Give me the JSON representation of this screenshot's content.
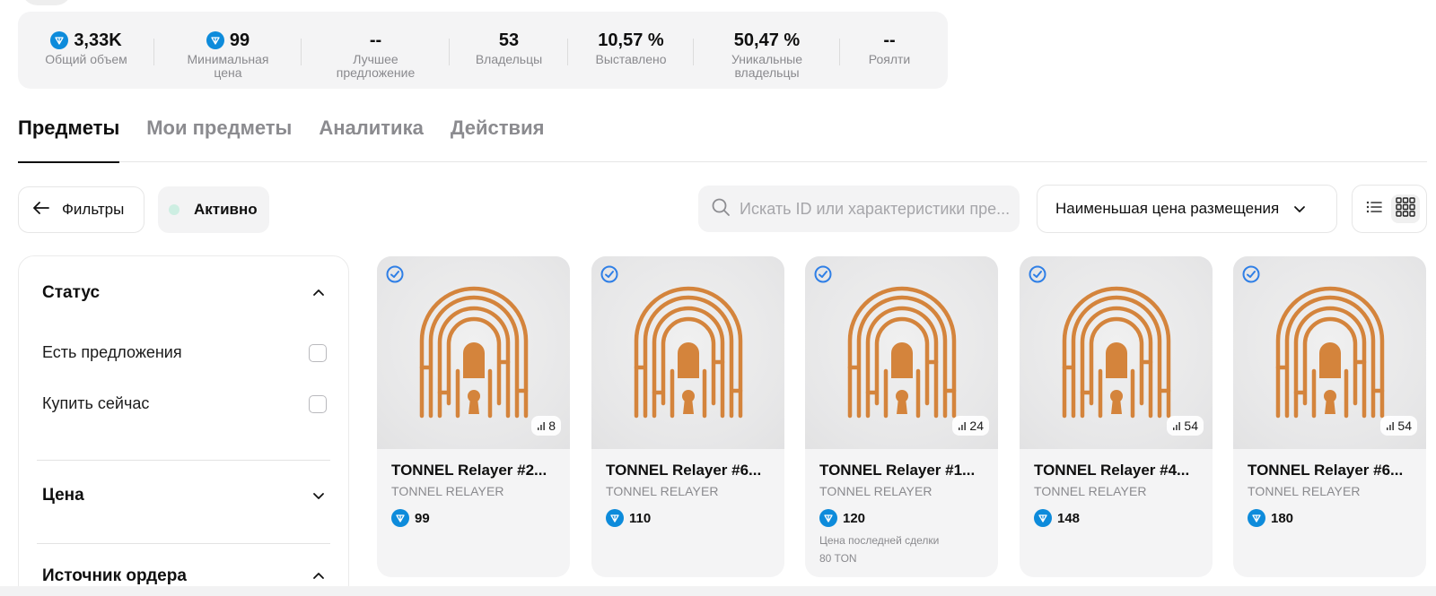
{
  "stats": [
    {
      "value": "3,33K",
      "label": "Общий объем",
      "ton": true
    },
    {
      "value": "99",
      "label": "Минимальная цена",
      "ton": true
    },
    {
      "value": "--",
      "label": "Лучшее предложение",
      "ton": false
    },
    {
      "value": "53",
      "label": "Владельцы",
      "ton": false
    },
    {
      "value": "10,57 %",
      "label": "Выставлено",
      "ton": false
    },
    {
      "value": "50,47 %",
      "label": "Уникальные владельцы",
      "ton": false
    },
    {
      "value": "--",
      "label": "Роялти",
      "ton": false
    }
  ],
  "tabs": [
    {
      "label": "Предметы",
      "active": true
    },
    {
      "label": "Мои предметы",
      "active": false
    },
    {
      "label": "Аналитика",
      "active": false
    },
    {
      "label": "Действия",
      "active": false
    }
  ],
  "toolbar": {
    "filters_label": "Фильтры",
    "active_label": "Активно",
    "search_placeholder": "Искать ID или характеристики пре...",
    "sort_label": "Наименьшая цена размещения"
  },
  "sidebar": {
    "status_title": "Статус",
    "options": [
      "Есть предложения",
      "Купить сейчас"
    ],
    "price_title": "Цена",
    "order_source_title": "Источник ордера"
  },
  "cards": [
    {
      "title": "TONNEL Relayer #2...",
      "collection": "TONNEL RELAYER",
      "price": "99",
      "rarity": "8",
      "last_sale_label": "",
      "last_sale_value": ""
    },
    {
      "title": "TONNEL Relayer #6...",
      "collection": "TONNEL RELAYER",
      "price": "110",
      "rarity": "",
      "last_sale_label": "",
      "last_sale_value": ""
    },
    {
      "title": "TONNEL Relayer #1...",
      "collection": "TONNEL RELAYER",
      "price": "120",
      "rarity": "24",
      "last_sale_label": "Цена последней сделки",
      "last_sale_value": "80 TON"
    },
    {
      "title": "TONNEL Relayer #4...",
      "collection": "TONNEL RELAYER",
      "price": "148",
      "rarity": "54",
      "last_sale_label": "",
      "last_sale_value": ""
    },
    {
      "title": "TONNEL Relayer #6...",
      "collection": "TONNEL RELAYER",
      "price": "180",
      "rarity": "54",
      "last_sale_label": "",
      "last_sale_value": ""
    }
  ],
  "colors": {
    "accent_ton": "#0d8bdb",
    "artwork": "#d4843c",
    "verified": "#2f7fe6"
  }
}
